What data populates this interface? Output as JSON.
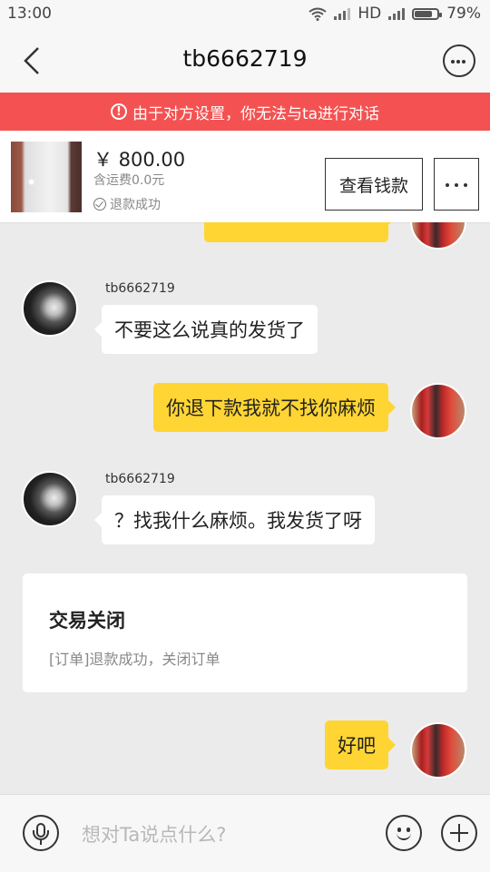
{
  "status_bar": {
    "time": "13:00",
    "network": "HD",
    "battery": "79%",
    "battery_level": 0.79
  },
  "nav": {
    "title": "tb6662719"
  },
  "banner": {
    "icon": "!",
    "text": "由于对方设置，你无法与ta进行对话"
  },
  "product": {
    "price": "￥ 800.00",
    "shipping": "含运费0.0元",
    "status": "退款成功",
    "view_button": "查看钱款"
  },
  "messages": [
    {
      "id": "m1",
      "from": "other",
      "sender": "tb6662719",
      "text": "不要这么说真的发货了"
    },
    {
      "id": "m2",
      "from": "self",
      "text": "你退下款我就不找你麻烦"
    },
    {
      "id": "m3",
      "from": "other",
      "sender": "tb6662719",
      "text": "？找我什么麻烦。我发货了呀"
    },
    {
      "id": "m4",
      "from": "self",
      "text": "好吧"
    }
  ],
  "order_card": {
    "title": "交易关闭",
    "desc": "[订单]退款成功，关闭订单"
  },
  "input": {
    "placeholder": "想对Ta说点什么?"
  },
  "colors": {
    "accent": "#ffd533",
    "banner": "#f45252",
    "background": "#ebebeb"
  }
}
